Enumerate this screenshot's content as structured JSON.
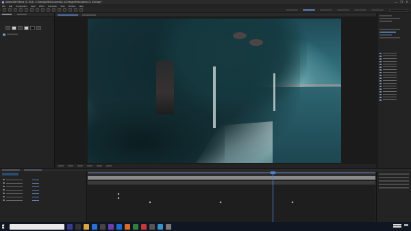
{
  "window": {
    "title": "Adobe After Effects CC 2018 - C:\\Users\\jpelle\\Documents\\1 oLD Magic\\Reflectutorial CC 2018.aep *",
    "controls": [
      "—",
      "❐",
      "✕"
    ]
  },
  "menu": [
    "File",
    "Edit",
    "Composition",
    "Layer",
    "Effect",
    "Animation",
    "View",
    "Window",
    "Help"
  ],
  "colors": {
    "accent": "#4c80d6",
    "panel": "#232323",
    "toolbar": "#262626",
    "taskbar": "#101622"
  },
  "icons": {
    "start": "windows-start-icon",
    "tools": [
      "home-icon",
      "selection-icon",
      "hand-icon",
      "zoom-icon",
      "rotate-icon",
      "camera-icon",
      "pan-behind-icon",
      "rectangle-icon",
      "pen-icon",
      "type-icon",
      "brush-icon",
      "clone-stamp-icon",
      "eraser-icon",
      "roto-brush-icon",
      "puppet-pin-icon"
    ]
  }
}
